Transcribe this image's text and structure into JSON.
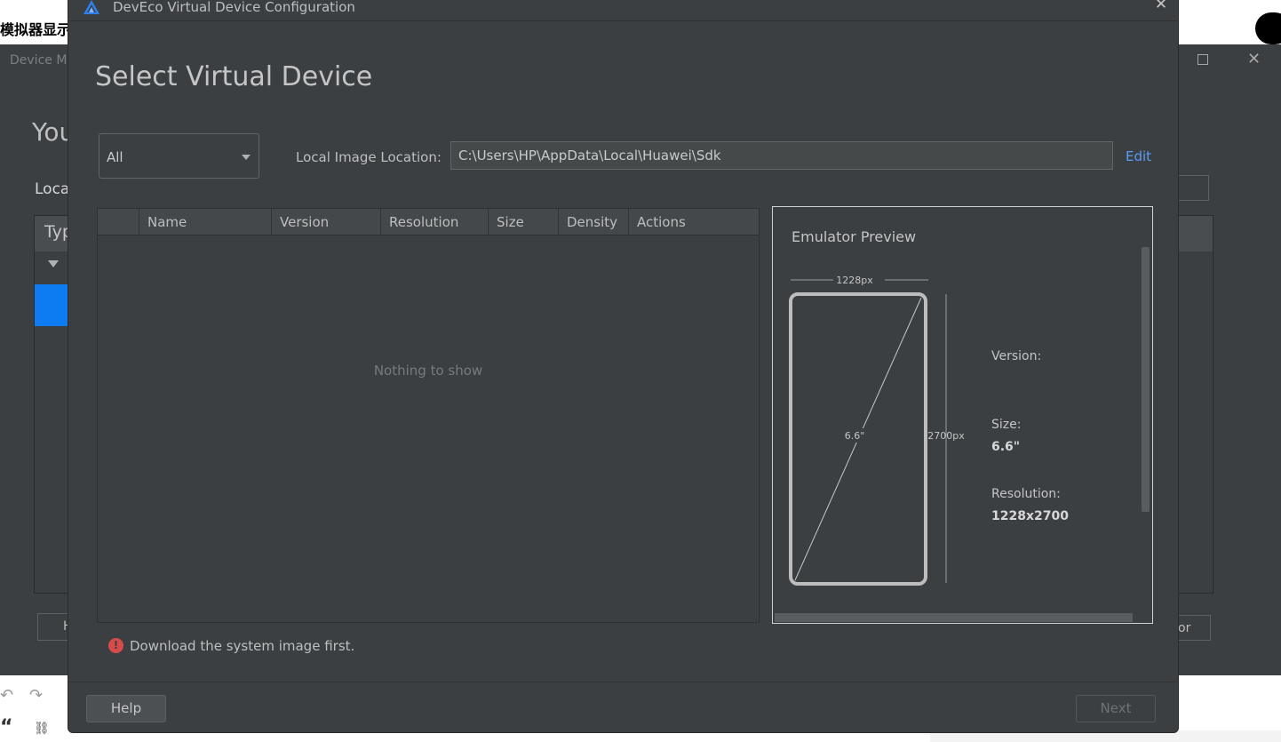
{
  "background": {
    "cn_text": "模拟器显示",
    "window_title": "Device M",
    "heading": "You",
    "local_label": "Loca",
    "type_header": "Typ",
    "left_button_label": "H",
    "right_button_label": "or"
  },
  "dialog": {
    "title": "DevEco Virtual Device Configuration",
    "close_icon": "close-icon",
    "page_title": "Select Virtual Device",
    "category": {
      "value": "All"
    },
    "location": {
      "label": "Local Image Location:",
      "value": "C:\\Users\\HP\\AppData\\Local\\Huawei\\Sdk",
      "edit_label": "Edit"
    },
    "table": {
      "columns": [
        "",
        "Name",
        "Version",
        "Resolution",
        "Size",
        "Density",
        "Actions"
      ],
      "empty_text": "Nothing to show"
    },
    "preview": {
      "title": "Emulator Preview",
      "width_label": "1228px",
      "height_label": "2700px",
      "diagonal_label": "6.6\"",
      "version_label": "Version:",
      "size_label": "Size:",
      "size_value": "6.6\"",
      "resolution_label": "Resolution:",
      "resolution_value": "1228x2700"
    },
    "error": {
      "icon": "error-icon",
      "text": "Download the system image first."
    },
    "buttons": {
      "help": "Help",
      "next": "Next"
    }
  },
  "colors": {
    "dialog_bg": "#3c3f41",
    "accent_link": "#589df6",
    "error": "#d84b4b",
    "selection_blue": "#0d7cf2"
  }
}
